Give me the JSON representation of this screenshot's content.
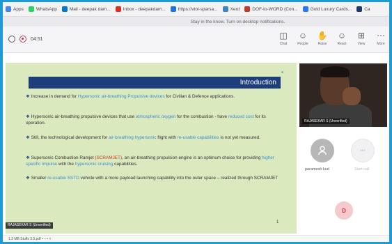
{
  "bookmarks": [
    {
      "label": "Apps",
      "icon": "apps-grid-icon",
      "color": "#4285f4"
    },
    {
      "label": "WhatsApp",
      "icon": "whatsapp-icon",
      "color": "#25d366"
    },
    {
      "label": "Mail - deepak dam...",
      "icon": "outlook-mail-icon",
      "color": "#0078d4"
    },
    {
      "label": "Inbox - deepakdam...",
      "icon": "gmail-icon",
      "color": "#d93025"
    },
    {
      "label": "https://vtol-sparsa...",
      "icon": "page-icon",
      "color": "#1a73e8"
    },
    {
      "label": "Xerd",
      "icon": "star-icon",
      "color": "#3d85c6"
    },
    {
      "label": "DOF-to-WORD (Con...",
      "icon": "document-icon",
      "color": "#c0392b"
    },
    {
      "label": "Gold Luxury Cards...",
      "icon": "card-icon",
      "color": "#2979ff"
    },
    {
      "label": "Ca",
      "icon": "calendar-icon",
      "color": "#1c3d6b"
    }
  ],
  "notification": "Stay in the know. Turn on desktop notifications.",
  "meeting": {
    "timer": "04:51",
    "toolbar_buttons": [
      {
        "label": "Chat",
        "icon": "chat-icon"
      },
      {
        "label": "People",
        "icon": "people-icon"
      },
      {
        "label": "Raise",
        "icon": "raise-hand-icon"
      },
      {
        "label": "React",
        "icon": "react-icon"
      },
      {
        "label": "View",
        "icon": "view-grid-icon"
      },
      {
        "label": "More",
        "icon": "more-icon"
      }
    ]
  },
  "slide": {
    "title": "Introduction",
    "page_number": "1",
    "presenter_tag": "RAJASEKAR S (Unverified)",
    "bullets": [
      {
        "parts": [
          {
            "t": "Increase in demand for ",
            "c": "n"
          },
          {
            "t": "Hypersonic air-breathing Propulsive devices",
            "c": "b"
          },
          {
            "t": " for Civilian & Defence applications.",
            "c": "n"
          }
        ]
      },
      {
        "parts": [
          {
            "t": "Hypersonic air-breathing propulsive devices that use ",
            "c": "n"
          },
          {
            "t": "atmospheric oxygen",
            "c": "b"
          },
          {
            "t": " for the combustion - have ",
            "c": "n"
          },
          {
            "t": "reduced cost",
            "c": "b"
          },
          {
            "t": " for its operation.",
            "c": "n"
          }
        ]
      },
      {
        "parts": [
          {
            "t": "Still, the technological development for ",
            "c": "n"
          },
          {
            "t": "air-breathing hypersonic",
            "c": "b"
          },
          {
            "t": " flight with ",
            "c": "n"
          },
          {
            "t": "re-usable capabilities",
            "c": "b"
          },
          {
            "t": " is not yet measured.",
            "c": "n"
          }
        ]
      },
      {
        "parts": [
          {
            "t": "Supersonic Combustion Ramjet ",
            "c": "n"
          },
          {
            "t": "(SCRAMJET)",
            "c": "r"
          },
          {
            "t": ", an air-breathing propulsion engine is an optimum choice for providing ",
            "c": "n"
          },
          {
            "t": "higher specific impulse",
            "c": "b"
          },
          {
            "t": " with the ",
            "c": "n"
          },
          {
            "t": "hypersonic cruising",
            "c": "b"
          },
          {
            "t": " capabilities.",
            "c": "n"
          }
        ]
      },
      {
        "parts": [
          {
            "t": "Smaller ",
            "c": "n"
          },
          {
            "t": "re-usable SSTO",
            "c": "b"
          },
          {
            "t": " vehicle with a more payload launching capability into the outer space – realized through SCRAMJET",
            "c": "n"
          }
        ]
      }
    ]
  },
  "participants": {
    "video_label": "RAJASEKAR S (Unverified)",
    "p1_name": "paramesh kud",
    "p2_name": "Start call",
    "d_initial": "D"
  },
  "download_bar": "1.3 MB Stuffs 3.5.pdf • – • ˄"
}
